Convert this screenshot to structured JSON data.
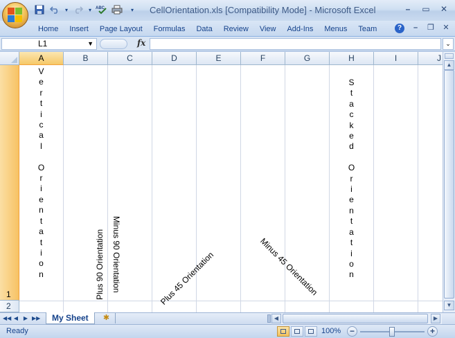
{
  "window": {
    "title": "CellOrientation.xls  [Compatibility Mode] - Microsoft Excel",
    "controls": {
      "minimize": "–",
      "restore": "▭",
      "close": "✕"
    },
    "doc_controls": {
      "minimize": "–",
      "restore": "❐",
      "close": "✕"
    }
  },
  "quick_access": {
    "icons": [
      "save-icon",
      "undo-icon",
      "redo-icon",
      "spelling-icon",
      "print-icon",
      "customize-icon"
    ],
    "glyphs": [
      "💾",
      "↶",
      "▾",
      "↷",
      "▾",
      "ᴬᴮᶜ✓",
      "⎙",
      "▾"
    ]
  },
  "ribbon": {
    "tabs": [
      "Home",
      "Insert",
      "Page Layout",
      "Formulas",
      "Data",
      "Review",
      "View",
      "Add-Ins",
      "Menus",
      "Team"
    ],
    "help": "?"
  },
  "formula_bar": {
    "name_box": "L1",
    "fx": "fx",
    "formula": ""
  },
  "grid": {
    "columns": [
      "A",
      "B",
      "C",
      "D",
      "E",
      "F",
      "G",
      "H",
      "I",
      "J"
    ],
    "active_column": "A",
    "rows": [
      "1",
      "2"
    ],
    "active_row": "1",
    "cells": {
      "A1": "Vertical Orientation",
      "B1": "Plus 90 Orientation",
      "C1": "Minus 90 Orientation",
      "D1": "Plus 45 Orientation",
      "F1": "Minus 45 Orientation",
      "H1": "Stacked Orientation"
    },
    "stacked_letters": {
      "A1": [
        "V",
        "e",
        "r",
        "t",
        "i",
        "c",
        "a",
        "l",
        "",
        "O",
        "r",
        "i",
        "e",
        "n",
        "t",
        "a",
        "t",
        "i",
        "o",
        "n"
      ],
      "H1": [
        "S",
        "t",
        "a",
        "c",
        "k",
        "e",
        "d",
        "",
        "O",
        "r",
        "i",
        "e",
        "n",
        "t",
        "a",
        "t",
        "i",
        "o",
        "n"
      ]
    }
  },
  "sheet_tabs": {
    "nav": [
      "◀◀",
      "◀",
      "▶",
      "▶▶"
    ],
    "tabs": [
      "My Sheet"
    ],
    "active": "My Sheet",
    "insert_glyph": "✱"
  },
  "status_bar": {
    "status": "Ready",
    "zoom": "100%",
    "zoom_minus": "−",
    "zoom_plus": "+"
  },
  "colors": {
    "ribbon_bg": "#c4d5ec",
    "active_header": "#f6c868",
    "gridline": "#d0d7e5",
    "text_blue": "#15428b"
  }
}
